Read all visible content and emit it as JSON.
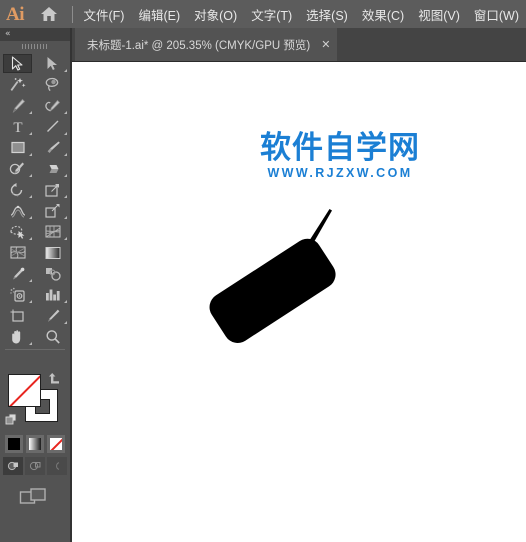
{
  "app": {
    "name": "Adobe Illustrator",
    "logo_text": "Ai",
    "home_icon": "home-icon"
  },
  "menubar": {
    "items": [
      {
        "label": "文件(F)",
        "name": "menu-file"
      },
      {
        "label": "编辑(E)",
        "name": "menu-edit"
      },
      {
        "label": "对象(O)",
        "name": "menu-object"
      },
      {
        "label": "文字(T)",
        "name": "menu-type"
      },
      {
        "label": "选择(S)",
        "name": "menu-select"
      },
      {
        "label": "效果(C)",
        "name": "menu-effect"
      },
      {
        "label": "视图(V)",
        "name": "menu-view"
      },
      {
        "label": "窗口(W)",
        "name": "menu-window"
      }
    ]
  },
  "tabbar": {
    "document_tab": {
      "label": "未标题-1.ai* @ 205.35% (CMYK/GPU 预览)",
      "close_label": "✕",
      "file_name": "未标题-1.ai",
      "modified": true,
      "zoom": "205.35%",
      "color_mode": "CMYK",
      "preview_mode": "GPU 预览"
    }
  },
  "toolbar": {
    "collapse_label": "«",
    "tools": [
      {
        "name": "selection-tool",
        "label": "选择工具",
        "active": true,
        "corner": false
      },
      {
        "name": "direct-selection-tool",
        "label": "直接选择工具",
        "active": false,
        "corner": true
      },
      {
        "name": "magic-wand-tool",
        "label": "魔棒工具",
        "active": false,
        "corner": false
      },
      {
        "name": "lasso-tool",
        "label": "套索工具",
        "active": false,
        "corner": false
      },
      {
        "name": "pen-tool",
        "label": "钢笔工具",
        "active": false,
        "corner": true
      },
      {
        "name": "curvature-tool",
        "label": "曲率工具",
        "active": false,
        "corner": true
      },
      {
        "name": "type-tool",
        "label": "文字工具",
        "active": false,
        "corner": true
      },
      {
        "name": "line-segment-tool",
        "label": "直线段工具",
        "active": false,
        "corner": true
      },
      {
        "name": "rectangle-tool",
        "label": "矩形工具",
        "active": false,
        "corner": true
      },
      {
        "name": "paintbrush-tool",
        "label": "画笔工具",
        "active": false,
        "corner": true
      },
      {
        "name": "shaper-tool",
        "label": "Shaper 工具",
        "active": false,
        "corner": true
      },
      {
        "name": "eraser-tool",
        "label": "橡皮擦工具",
        "active": false,
        "corner": true
      },
      {
        "name": "rotate-tool",
        "label": "旋转工具",
        "active": false,
        "corner": true
      },
      {
        "name": "scale-tool",
        "label": "缩放工具",
        "active": false,
        "corner": true
      },
      {
        "name": "width-tool",
        "label": "宽度工具",
        "active": false,
        "corner": true
      },
      {
        "name": "free-transform-tool",
        "label": "自由变换工具",
        "active": false,
        "corner": true
      },
      {
        "name": "shape-builder-tool",
        "label": "形状生成器工具",
        "active": false,
        "corner": true
      },
      {
        "name": "perspective-grid-tool",
        "label": "透视网格工具",
        "active": false,
        "corner": true
      },
      {
        "name": "mesh-tool",
        "label": "网格工具",
        "active": false,
        "corner": false
      },
      {
        "name": "gradient-tool",
        "label": "渐变工具",
        "active": false,
        "corner": false
      },
      {
        "name": "eyedropper-tool",
        "label": "吸管工具",
        "active": false,
        "corner": true
      },
      {
        "name": "blend-tool",
        "label": "混合工具",
        "active": false,
        "corner": false
      },
      {
        "name": "symbol-sprayer-tool",
        "label": "符号喷枪工具",
        "active": false,
        "corner": true
      },
      {
        "name": "column-graph-tool",
        "label": "柱形图工具",
        "active": false,
        "corner": true
      },
      {
        "name": "artboard-tool",
        "label": "画板工具",
        "active": false,
        "corner": false
      },
      {
        "name": "slice-tool",
        "label": "切片工具",
        "active": false,
        "corner": true
      },
      {
        "name": "hand-tool",
        "label": "抓手工具",
        "active": false,
        "corner": true
      },
      {
        "name": "zoom-tool",
        "label": "缩放工具",
        "active": false,
        "corner": false
      }
    ],
    "color_controls": {
      "fill_label": "填色",
      "fill_value": "无",
      "stroke_label": "描边",
      "stroke_value": "黑色",
      "swap_icon": "swap-fill-stroke-icon",
      "default_icon": "default-fill-stroke-icon",
      "modes": [
        {
          "name": "color-mode-solid",
          "label": "颜色",
          "selected": true
        },
        {
          "name": "color-mode-gradient",
          "label": "渐变",
          "selected": false
        },
        {
          "name": "color-mode-none",
          "label": "无",
          "selected": false
        }
      ],
      "screen_modes": [
        {
          "name": "screen-mode-normal",
          "label": "正常屏幕模式",
          "selected": true
        },
        {
          "name": "screen-mode-fullmenu",
          "label": "带有菜单栏的全屏模式",
          "selected": false
        },
        {
          "name": "screen-mode-full",
          "label": "全屏模式",
          "selected": false
        }
      ],
      "arrange_icon": "change-screen-mode-icon"
    }
  },
  "canvas": {
    "watermark": {
      "chinese": "软件自学网",
      "url": "WWW.RJZXW.COM",
      "color": "#1b7fd4"
    },
    "artwork": {
      "name": "rotated-rounded-rectangle-with-antenna",
      "fill_color": "#000000",
      "rotation_deg": -33
    }
  },
  "colors": {
    "menubar_bg": "#5c5c5c",
    "tabbar_bg": "#444444",
    "tab_active_bg": "#535353",
    "toolbar_bg": "#535353",
    "canvas_bg": "#ffffff",
    "accent_orange": "#e09b63",
    "watermark_blue": "#1b7fd4",
    "none_red": "#e8251f"
  }
}
